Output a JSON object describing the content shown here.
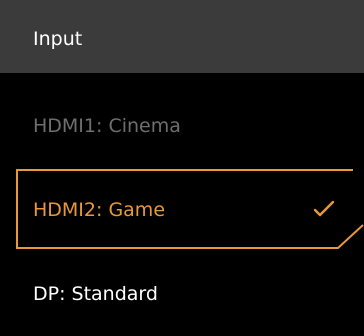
{
  "header": {
    "title": "Input"
  },
  "menu": {
    "items": [
      {
        "label": "HDMI1: Cinema",
        "state": "disabled"
      },
      {
        "label": "HDMI2: Game",
        "state": "selected",
        "checked": true
      },
      {
        "label": "DP: Standard",
        "state": "normal"
      }
    ]
  },
  "colors": {
    "header_bg": "#3b3b3b",
    "background": "#000000",
    "accent": "#e8983b",
    "disabled_text": "#6e6e6e",
    "text": "#ffffff"
  },
  "icons": {
    "selected_check": "check-icon"
  }
}
